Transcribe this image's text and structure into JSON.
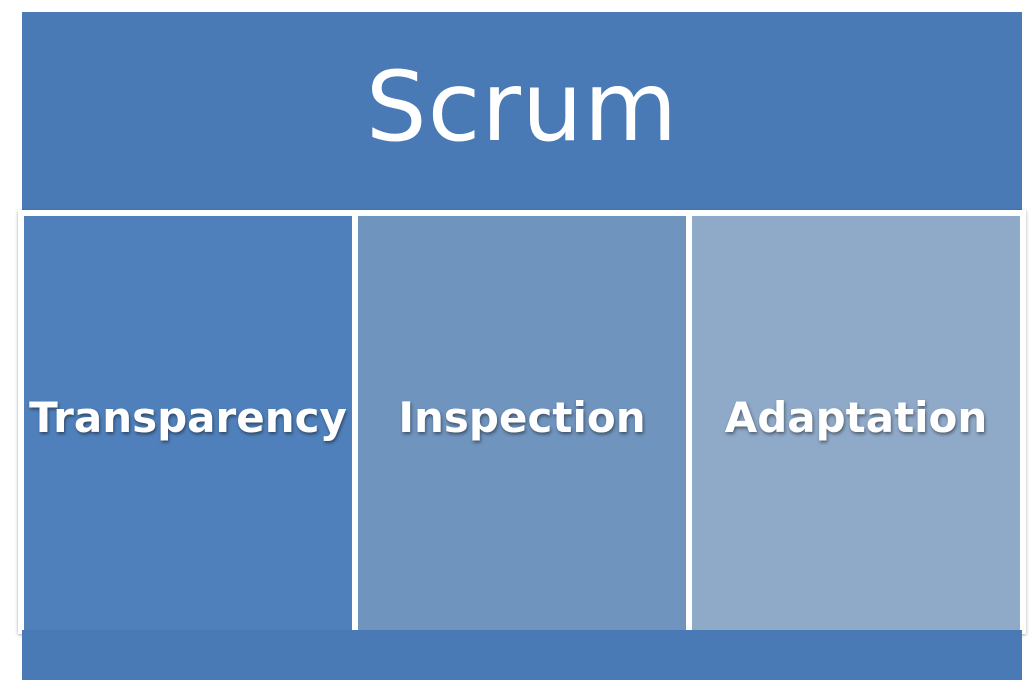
{
  "title": "Scrum",
  "pillars": [
    {
      "label": "Transparency"
    },
    {
      "label": "Inspection"
    },
    {
      "label": "Adaptation"
    }
  ],
  "colors": {
    "primary": "#4a7ab5",
    "pillar_1": "#5080bb",
    "pillar_2": "#6f94be",
    "pillar_3": "#8fa9c8",
    "text": "#ffffff"
  }
}
